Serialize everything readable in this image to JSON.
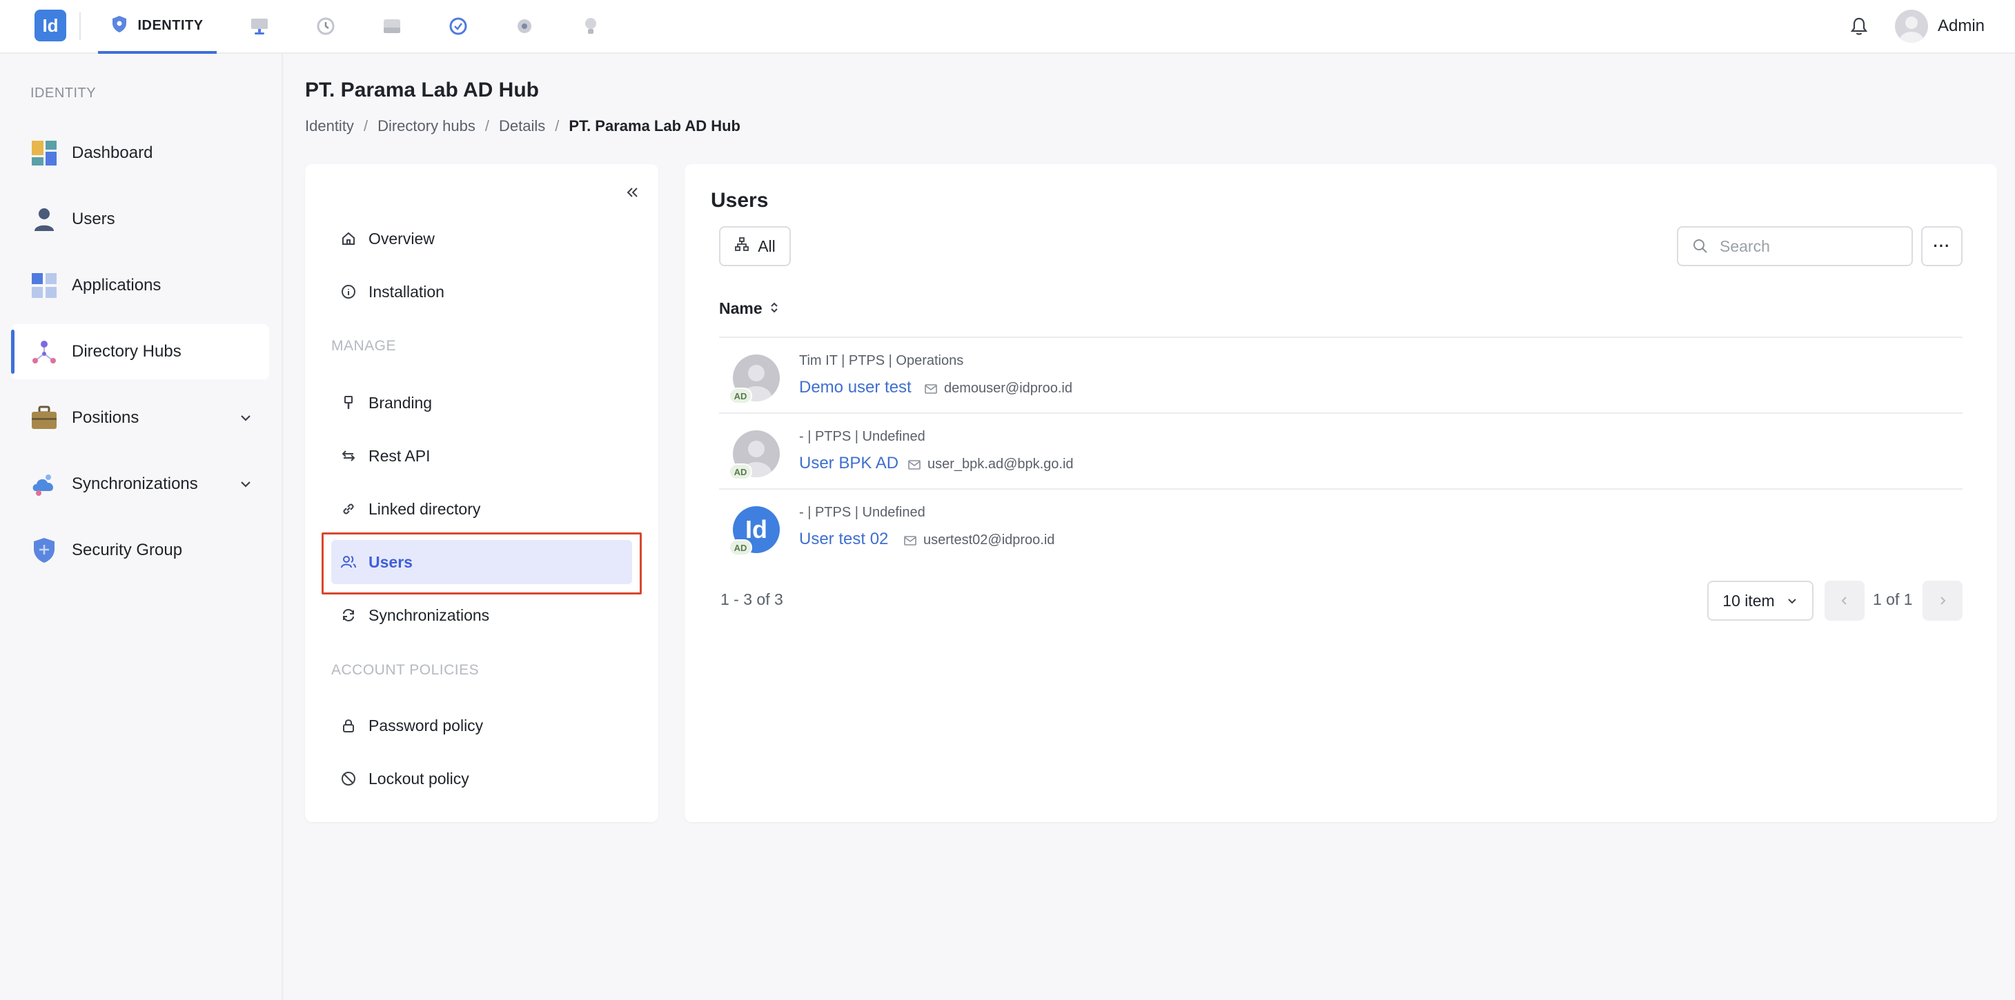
{
  "app": {
    "logo_text": "Id",
    "active_tab": "IDENTITY",
    "top_icons": [
      "monitor-icon",
      "history-icon",
      "drive-icon",
      "check-circle-icon",
      "gear-icon",
      "bulb-icon"
    ],
    "user_name": "Admin"
  },
  "sidebar": {
    "section": "IDENTITY",
    "items": [
      {
        "label": "Dashboard"
      },
      {
        "label": "Users"
      },
      {
        "label": "Applications"
      },
      {
        "label": "Directory Hubs"
      },
      {
        "label": "Positions"
      },
      {
        "label": "Synchronizations"
      },
      {
        "label": "Security Group"
      }
    ]
  },
  "page": {
    "title": "PT. Parama Lab AD Hub",
    "breadcrumb": [
      "Identity",
      "Directory hubs",
      "Details",
      "PT. Parama Lab AD Hub"
    ]
  },
  "local_nav": {
    "items_top": [
      {
        "label": "Overview"
      },
      {
        "label": "Installation"
      }
    ],
    "section_manage": "MANAGE",
    "items_manage": [
      {
        "label": "Branding"
      },
      {
        "label": "Rest API"
      },
      {
        "label": "Linked directory"
      },
      {
        "label": "Users"
      },
      {
        "label": "Synchronizations"
      }
    ],
    "section_policies": "ACCOUNT POLICIES",
    "items_policies": [
      {
        "label": "Password policy"
      },
      {
        "label": "Lockout policy"
      }
    ]
  },
  "users_panel": {
    "title": "Users",
    "filter_label": "All",
    "search_placeholder": "Search",
    "more_label": "···",
    "column_name": "Name",
    "rows": [
      {
        "meta": "Tim IT | PTPS | Operations",
        "name": "Demo user test",
        "email": "demouser@idproo.id",
        "badge": "AD"
      },
      {
        "meta": "- | PTPS | Undefined",
        "name": "User BPK AD",
        "email": "user_bpk.ad@bpk.go.id",
        "badge": "AD"
      },
      {
        "meta": "- | PTPS | Undefined",
        "name": "User test 02",
        "email": "usertest02@idproo.id",
        "badge": "AD",
        "avatar_text": "Id"
      }
    ],
    "count_text": "1 - 3 of 3",
    "per_page": "10 item",
    "page_text": "1 of 1"
  },
  "colors": {
    "accent": "#3f70d9",
    "link": "#3f6fd0",
    "highlight": "#d9472e"
  }
}
